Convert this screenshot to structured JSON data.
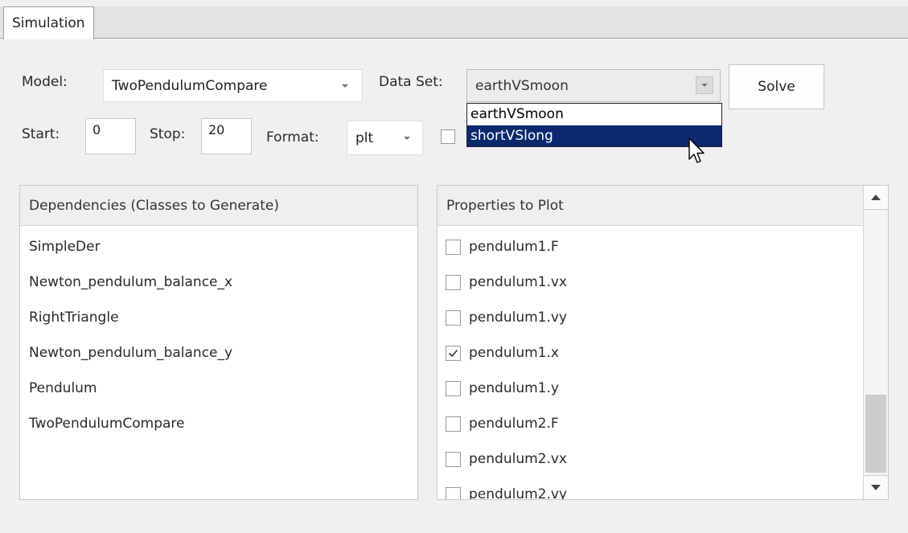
{
  "tab": {
    "label": "Simulation"
  },
  "model": {
    "label": "Model:",
    "value": "TwoPendulumCompare"
  },
  "dataset": {
    "label": "Data Set:",
    "value": "earthVSmoon",
    "options": [
      "earthVSmoon",
      "shortVSlong"
    ],
    "highlighted": "shortVSlong"
  },
  "solve_label": "Solve",
  "start": {
    "label": "Start:",
    "value": "0"
  },
  "stop": {
    "label": "Stop:",
    "value": "20"
  },
  "format": {
    "label": "Format:",
    "value": "plt"
  },
  "dependencies": {
    "header": "Dependencies (Classes to Generate)",
    "items": [
      "SimpleDer",
      "Newton_pendulum_balance_x",
      "RightTriangle",
      "Newton_pendulum_balance_y",
      "Pendulum",
      "TwoPendulumCompare"
    ]
  },
  "properties": {
    "header": "Properties to Plot",
    "items": [
      {
        "label": "pendulum1.F",
        "checked": false
      },
      {
        "label": "pendulum1.vx",
        "checked": false
      },
      {
        "label": "pendulum1.vy",
        "checked": false
      },
      {
        "label": "pendulum1.x",
        "checked": true
      },
      {
        "label": "pendulum1.y",
        "checked": false
      },
      {
        "label": "pendulum2.F",
        "checked": false
      },
      {
        "label": "pendulum2.vx",
        "checked": false
      },
      {
        "label": "pendulum2.vy",
        "checked": false
      }
    ]
  },
  "colors": {
    "selection": "#0b2a6e",
    "background": "#f0f0f0"
  }
}
